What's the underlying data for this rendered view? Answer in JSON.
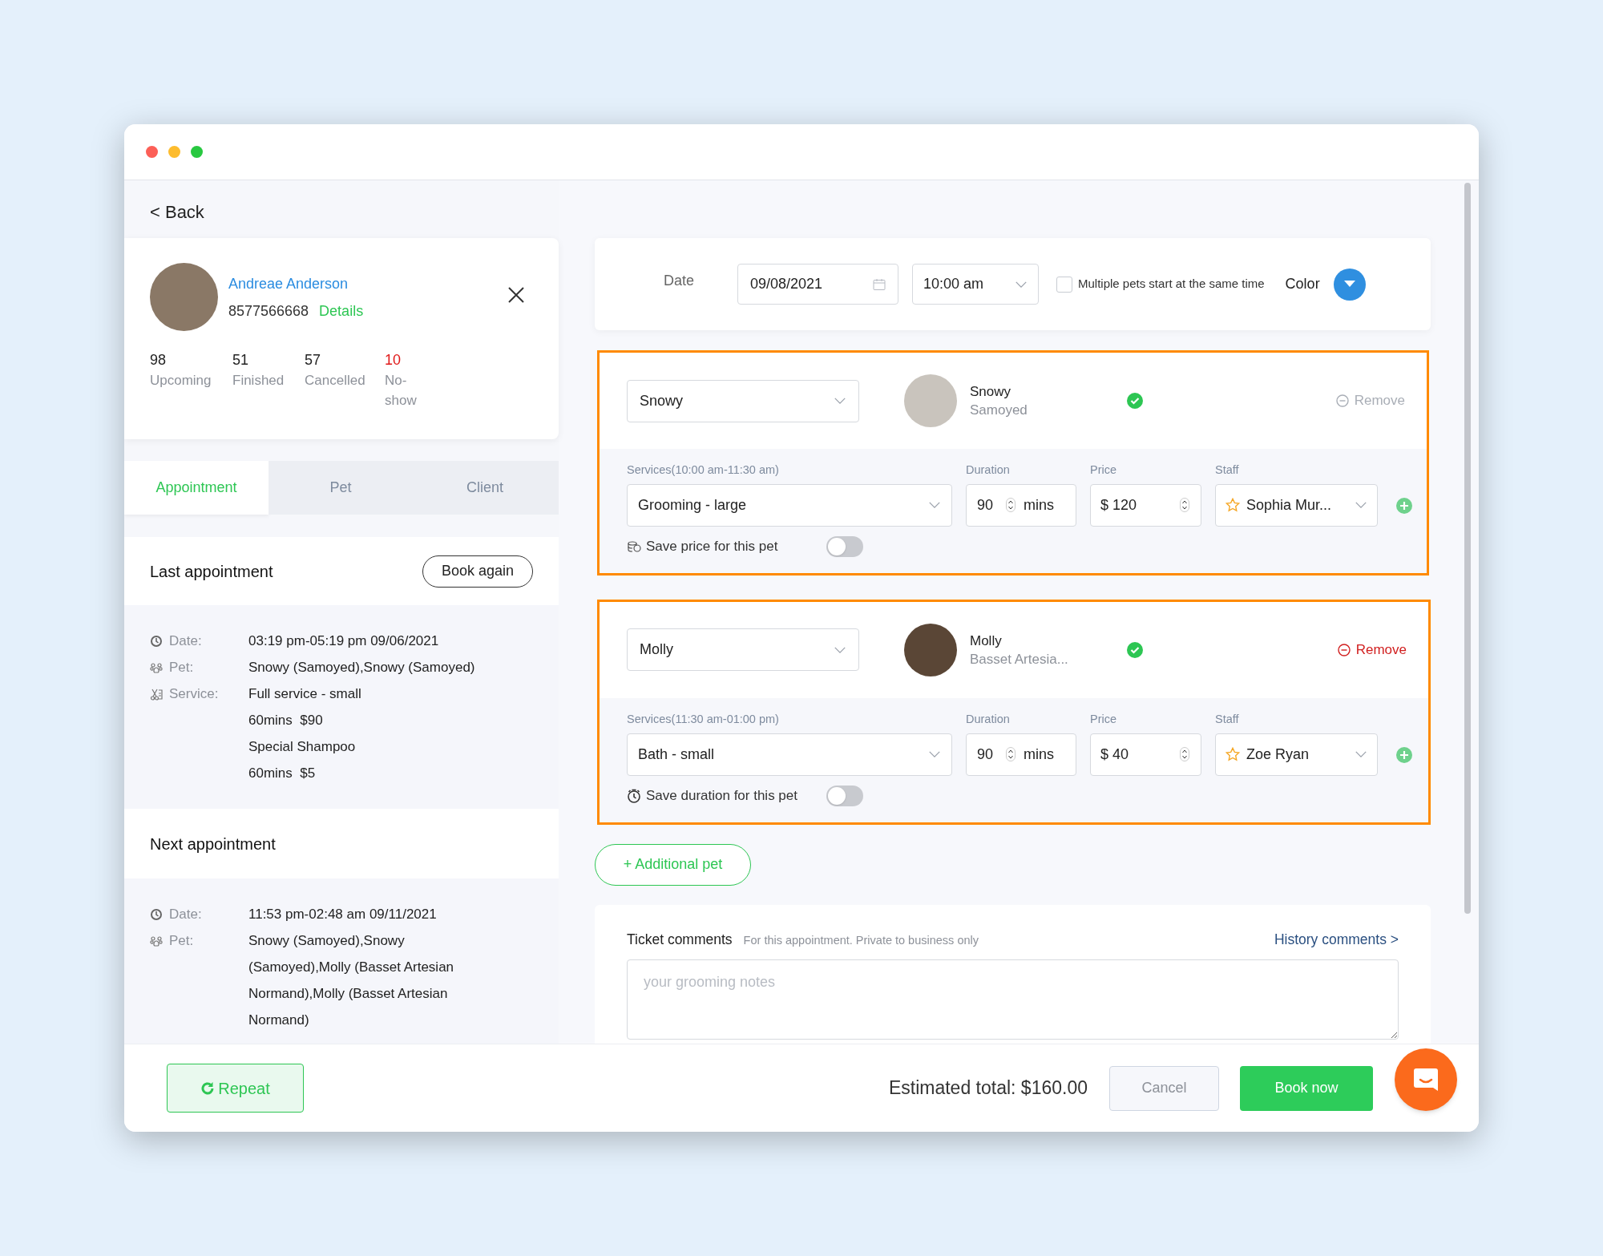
{
  "back": "< Back",
  "client": {
    "name": "Andreae Anderson",
    "phone": "8577566668",
    "details_link": "Details",
    "stats": [
      {
        "value": "98",
        "label": "Upcoming",
        "alert": false
      },
      {
        "value": "51",
        "label": "Finished",
        "alert": false
      },
      {
        "value": "57",
        "label": "Cancelled",
        "alert": false
      },
      {
        "value": "10",
        "label": "No-show",
        "alert": true
      }
    ]
  },
  "tabs": [
    {
      "label": "Appointment",
      "selected": true
    },
    {
      "label": "Pet",
      "selected": false
    },
    {
      "label": "Client",
      "selected": false
    }
  ],
  "last_appointment": {
    "title": "Last appointment",
    "button": "Book again",
    "rows": [
      {
        "kind": "date",
        "label": "Date:",
        "values": [
          "03:19 pm-05:19 pm 09/06/2021"
        ]
      },
      {
        "kind": "pet",
        "label": "Pet:",
        "values": [
          "Snowy (Samoyed),Snowy (Samoyed)"
        ]
      },
      {
        "kind": "service",
        "label": "Service:",
        "values": [
          "Full service - small",
          "60mins  $90",
          "Special Shampoo",
          "60mins  $5"
        ]
      }
    ]
  },
  "next_appointment": {
    "title": "Next appointment",
    "rows": [
      {
        "kind": "date",
        "label": "Date:",
        "values": [
          "11:53 pm-02:48 am 09/11/2021"
        ]
      },
      {
        "kind": "pet",
        "label": "Pet:",
        "values": [
          "Snowy (Samoyed),Snowy (Samoyed),Molly (Basset Artesian Normand),Molly (Basset Artesian Normand)"
        ]
      }
    ]
  },
  "schedule": {
    "date_label": "Date",
    "date": "09/08/2021",
    "time": "10:00 am",
    "multiple_pets": {
      "label": "Multiple pets start at the same time",
      "checked": false
    },
    "color_label": "Color",
    "color": "#2f8fe0"
  },
  "pets": [
    {
      "select": "Snowy",
      "name": "Snowy",
      "breed": "Samoyed",
      "confirmed": true,
      "remove": {
        "label": "Remove",
        "disabled": true
      },
      "services_label": "Services(10:00 am-11:30 am)",
      "service": "Grooming - large",
      "duration_label": "Duration",
      "duration": "90",
      "unit": "mins",
      "price_label": "Price",
      "price": "$ 120",
      "staff_label": "Staff",
      "staff": "Sophia Mur...",
      "save": {
        "kind": "price",
        "label": "Save price for this pet",
        "on": false
      }
    },
    {
      "select": "Molly",
      "name": "Molly",
      "breed": "Basset Artesia...",
      "confirmed": true,
      "remove": {
        "label": "Remove",
        "disabled": false
      },
      "services_label": "Services(11:30 am-01:00 pm)",
      "service": "Bath - small",
      "duration_label": "Duration",
      "duration": "90",
      "unit": "mins",
      "price_label": "Price",
      "price": "$ 40",
      "staff_label": "Staff",
      "staff": "Zoe Ryan",
      "save": {
        "kind": "duration",
        "label": "Save duration for this pet",
        "on": false
      }
    }
  ],
  "additional_pet": "+ Additional pet",
  "comments": {
    "title": "Ticket comments",
    "hint": "For this appointment. Private to business only",
    "history_link": "History comments >",
    "placeholder": "your grooming notes"
  },
  "footer": {
    "repeat": "Repeat",
    "total": "Estimated total: $160.00",
    "cancel": "Cancel",
    "book": "Book now"
  }
}
